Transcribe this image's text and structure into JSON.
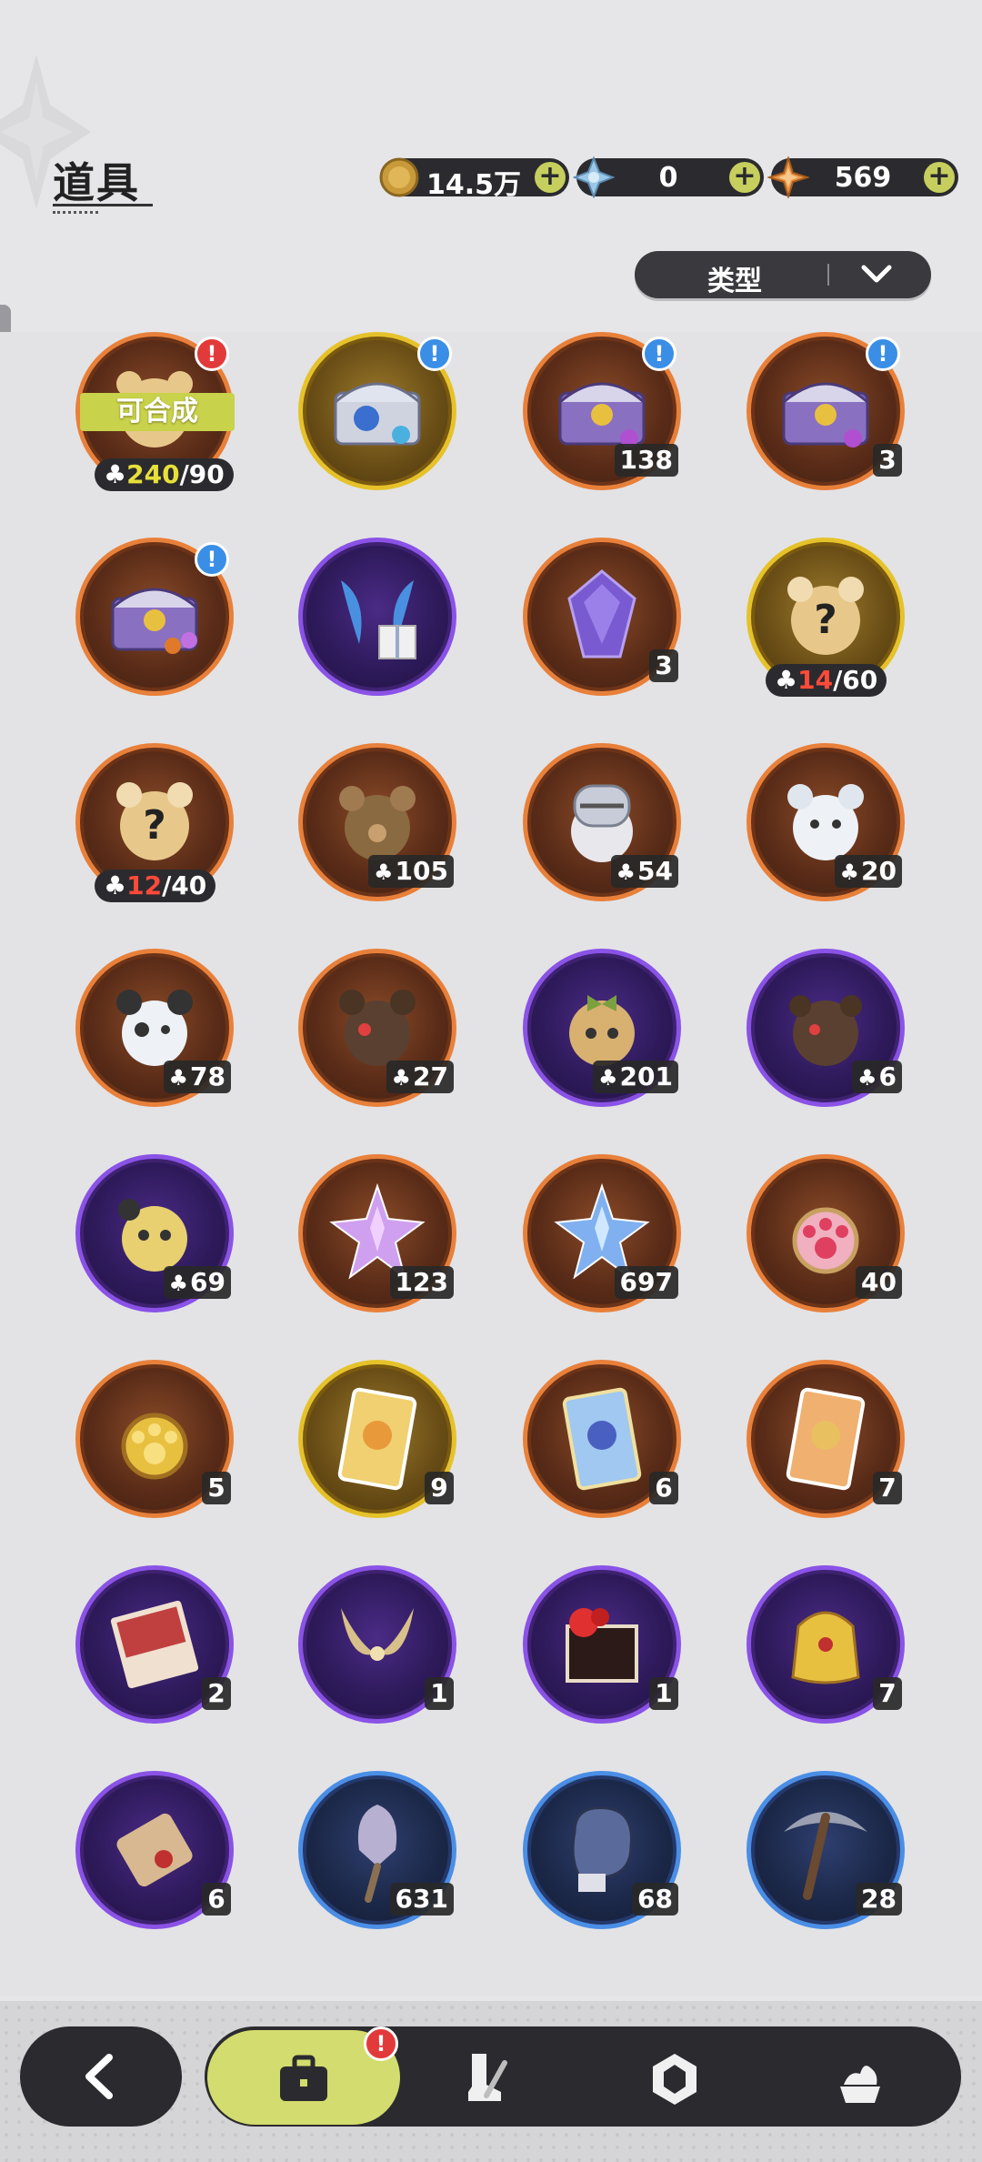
{
  "header": {
    "title": "道具"
  },
  "currencies": [
    {
      "name": "gold-coin",
      "value": "14.5万",
      "color": "#c89a3a"
    },
    {
      "name": "crystal",
      "value": "0",
      "color": "#9ac8e6"
    },
    {
      "name": "star-gem",
      "value": "569",
      "color": "#e6964a"
    }
  ],
  "plus_label": "+",
  "filter": {
    "label": "类型"
  },
  "synth_label": "可合成",
  "alert_glyph": "!",
  "items": [
    {
      "icon": "bear-puzzle",
      "frame": "orange",
      "alert": "red",
      "synth": true,
      "have": "240",
      "need": "/90"
    },
    {
      "icon": "chest-blue-gems",
      "frame": "gold",
      "alert": "blue"
    },
    {
      "icon": "chest-purple-gems",
      "frame": "orange",
      "alert": "blue",
      "count": "138"
    },
    {
      "icon": "chest-purple-gems",
      "frame": "orange",
      "alert": "blue",
      "count": "3"
    },
    {
      "icon": "chest-purple-orbs",
      "frame": "orange",
      "alert": "blue"
    },
    {
      "icon": "wings-gift",
      "frame": "purple"
    },
    {
      "icon": "purple-crystal",
      "frame": "orange",
      "count": "3"
    },
    {
      "icon": "mystery-bear",
      "frame": "gold",
      "have": "14",
      "need": "/60",
      "low": true
    },
    {
      "icon": "mystery-bear",
      "frame": "orange",
      "have": "12",
      "need": "/40",
      "low": true
    },
    {
      "icon": "bear-brown",
      "frame": "orange",
      "count": "105",
      "puzzle": true
    },
    {
      "icon": "bear-knight",
      "frame": "orange",
      "count": "54",
      "puzzle": true
    },
    {
      "icon": "bear-white",
      "frame": "orange",
      "count": "20",
      "puzzle": true
    },
    {
      "icon": "bear-white-spotted",
      "frame": "orange",
      "count": "78",
      "puzzle": true
    },
    {
      "icon": "bear-dark",
      "frame": "orange",
      "count": "27",
      "puzzle": true
    },
    {
      "icon": "bear-bow",
      "frame": "purple",
      "count": "201",
      "puzzle": true
    },
    {
      "icon": "bear-dark-small",
      "frame": "purple",
      "count": "6",
      "puzzle": true
    },
    {
      "icon": "bear-yellow",
      "frame": "purple",
      "count": "69",
      "puzzle": true
    },
    {
      "icon": "pink-star-crystal",
      "frame": "orange",
      "count": "123"
    },
    {
      "icon": "blue-star-crystal",
      "frame": "orange",
      "count": "697"
    },
    {
      "icon": "pink-paw-charm",
      "frame": "orange",
      "count": "40"
    },
    {
      "icon": "gold-paw-charm",
      "frame": "orange",
      "count": "5"
    },
    {
      "icon": "gold-card",
      "frame": "gold",
      "count": "9"
    },
    {
      "icon": "blue-card",
      "frame": "orange",
      "count": "6"
    },
    {
      "icon": "orange-card",
      "frame": "orange",
      "count": "7"
    },
    {
      "icon": "red-envelope",
      "frame": "purple",
      "count": "2"
    },
    {
      "icon": "golden-horns",
      "frame": "purple",
      "count": "1"
    },
    {
      "icon": "flower-gift",
      "frame": "purple",
      "count": "1"
    },
    {
      "icon": "golden-bell",
      "frame": "purple",
      "count": "7"
    },
    {
      "icon": "scroll",
      "frame": "purple",
      "count": "6"
    },
    {
      "icon": "shovel",
      "frame": "blue",
      "count": "631"
    },
    {
      "icon": "boxing-glove",
      "frame": "blue",
      "count": "68"
    },
    {
      "icon": "pickaxe",
      "frame": "blue",
      "count": "28"
    }
  ],
  "bottom_nav": [
    {
      "name": "back-icon"
    },
    {
      "name": "bag-icon",
      "active": true,
      "alert": "!"
    },
    {
      "name": "boot-sword-icon"
    },
    {
      "name": "hexagon-gem-icon"
    },
    {
      "name": "cream-pot-icon"
    }
  ]
}
